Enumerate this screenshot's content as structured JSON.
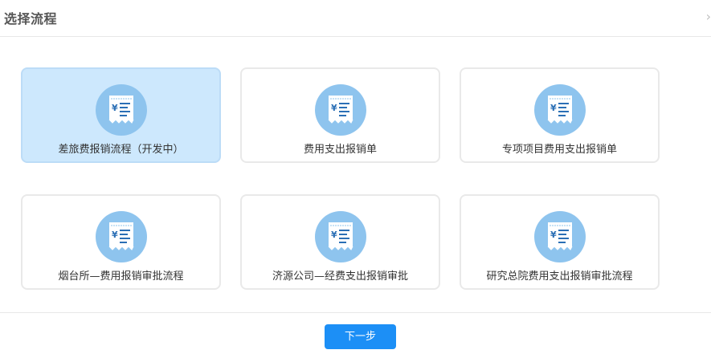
{
  "dialog": {
    "title": "选择流程",
    "close_glyph": "›"
  },
  "cards": [
    {
      "label": "差旅费报销流程（开发中）",
      "selected": true,
      "icon": "receipt-icon"
    },
    {
      "label": "费用支出报销单",
      "selected": false,
      "icon": "receipt-icon"
    },
    {
      "label": "专项项目费用支出报销单",
      "selected": false,
      "icon": "receipt-icon"
    },
    {
      "label": "烟台所—费用报销审批流程",
      "selected": false,
      "icon": "receipt-icon"
    },
    {
      "label": "济源公司—经费支出报销审批",
      "selected": false,
      "icon": "receipt-icon"
    },
    {
      "label": "研究总院费用支出报销审批流程",
      "selected": false,
      "icon": "receipt-icon"
    }
  ],
  "footer": {
    "next_label": "下一步"
  },
  "colors": {
    "accent": "#1c8ff6",
    "selected_bg": "#cde8fd",
    "icon_circle": "#8ec4ee"
  }
}
